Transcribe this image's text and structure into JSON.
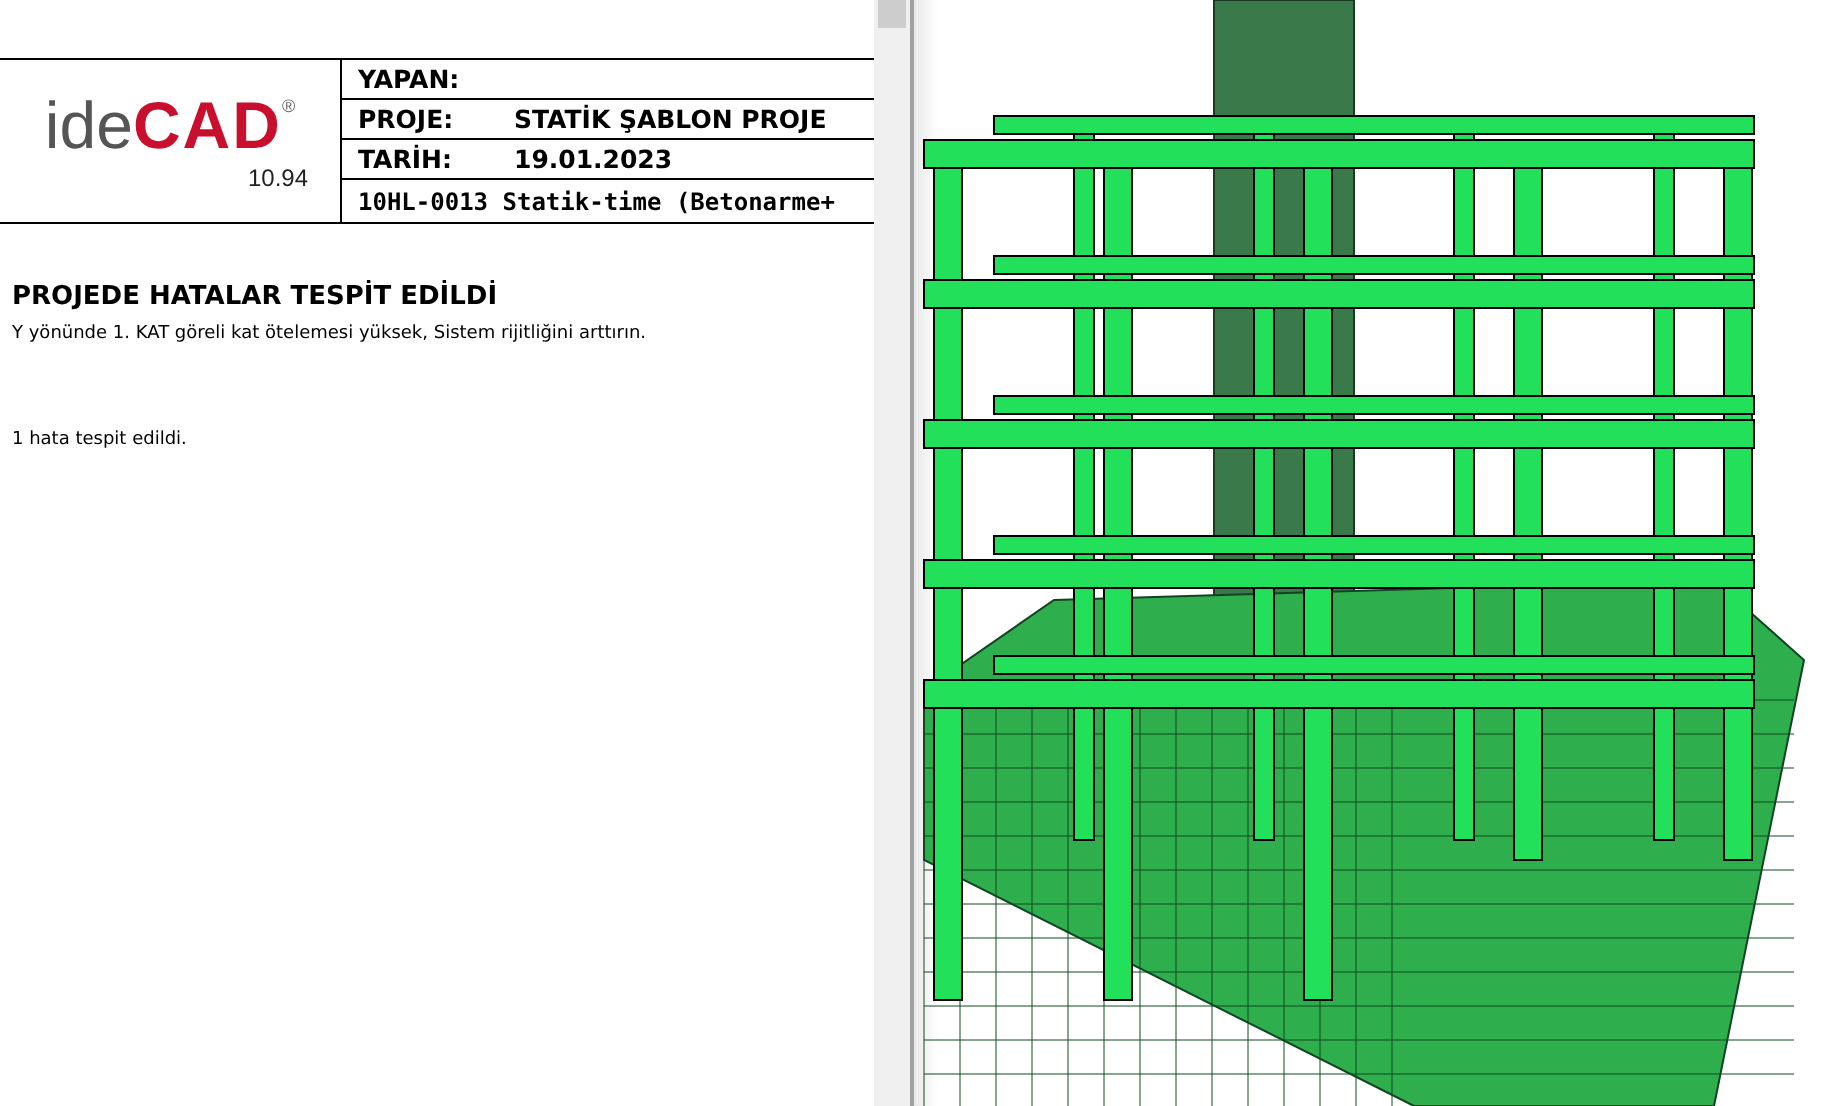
{
  "logo": {
    "prefix": "ide",
    "brand": "CAD",
    "mark": "®",
    "version": "10.94"
  },
  "header": {
    "rows": [
      {
        "label": "YAPAN:",
        "value": ""
      },
      {
        "label": "PROJE:",
        "value": "STATİK ŞABLON PROJE"
      },
      {
        "label": "TARİH:",
        "value": "19.01.2023"
      }
    ],
    "subtitle": "10HL-0013 Statik-time (Betonarme+"
  },
  "report": {
    "title": "PROJEDE HATALAR TESPİT EDİLDİ",
    "messages": [
      "Y yönünde 1. KAT göreli kat ötelemesi yüksek, Sistem rijitliğini arttırın."
    ],
    "summary": "1 hata tespit edildi."
  }
}
